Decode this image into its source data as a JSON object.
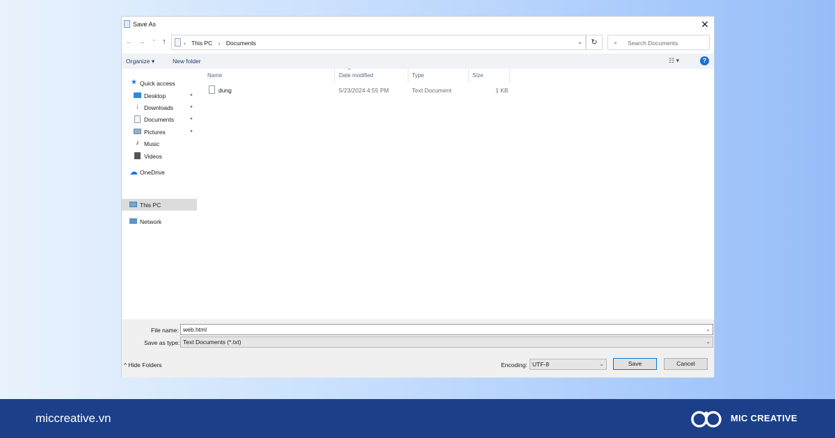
{
  "dialog": {
    "title": "Save As",
    "close_glyph": "✕"
  },
  "address": {
    "back_glyph": "←",
    "forward_glyph": "→",
    "recent_glyph": "⌄",
    "up_glyph": "↑",
    "crumbs": [
      "This PC",
      "Documents"
    ],
    "separator": "›",
    "dropdown_glyph": "⌄",
    "refresh_glyph": "↻",
    "search_placeholder": "Search Documents",
    "search_glyph": "⌕"
  },
  "toolbar": {
    "organize": "Organize ▾",
    "new_folder": "New folder",
    "view_glyph": "☷ ▾",
    "help_glyph": "?"
  },
  "nav": {
    "quick_access": "Quick access",
    "items": [
      {
        "label": "Desktop",
        "icon": "desktop-icon",
        "pinned": true
      },
      {
        "label": "Downloads",
        "icon": "downloads-icon",
        "pinned": true
      },
      {
        "label": "Documents",
        "icon": "documents-icon",
        "pinned": true
      },
      {
        "label": "Pictures",
        "icon": "pictures-icon",
        "pinned": true
      },
      {
        "label": "Music",
        "icon": "music-icon",
        "pinned": false
      },
      {
        "label": "Videos",
        "icon": "videos-icon",
        "pinned": false
      }
    ],
    "onedrive": "OneDrive",
    "this_pc": "This PC",
    "network": "Network",
    "pin_glyph": "📌"
  },
  "columns": {
    "name": "Name",
    "date_modified": "Date modified",
    "type": "Type",
    "size": "Size",
    "sort_glyph": "^"
  },
  "files": [
    {
      "name": "dung",
      "date_modified": "5/23/2024 4:55 PM",
      "type": "Text Document",
      "size": "1 KB"
    }
  ],
  "form": {
    "file_name_label": "File name:",
    "file_name_value": "web.html",
    "save_as_type_label": "Save as type:",
    "save_as_type_value": "Text Documents (*.txt)",
    "encoding_label": "Encoding:",
    "encoding_value": "UTF-8",
    "save": "Save",
    "cancel": "Cancel",
    "hide_folders": "Hide Folders",
    "dropdown_glyph": "⌄",
    "hide_glyph": "^"
  },
  "footer": {
    "url": "miccreative.vn",
    "brand": "MIC CREATIVE"
  },
  "colors": {
    "footer_bg": "#1b4089",
    "accent": "#0078d7",
    "selected_bg": "#dcdcdc"
  }
}
